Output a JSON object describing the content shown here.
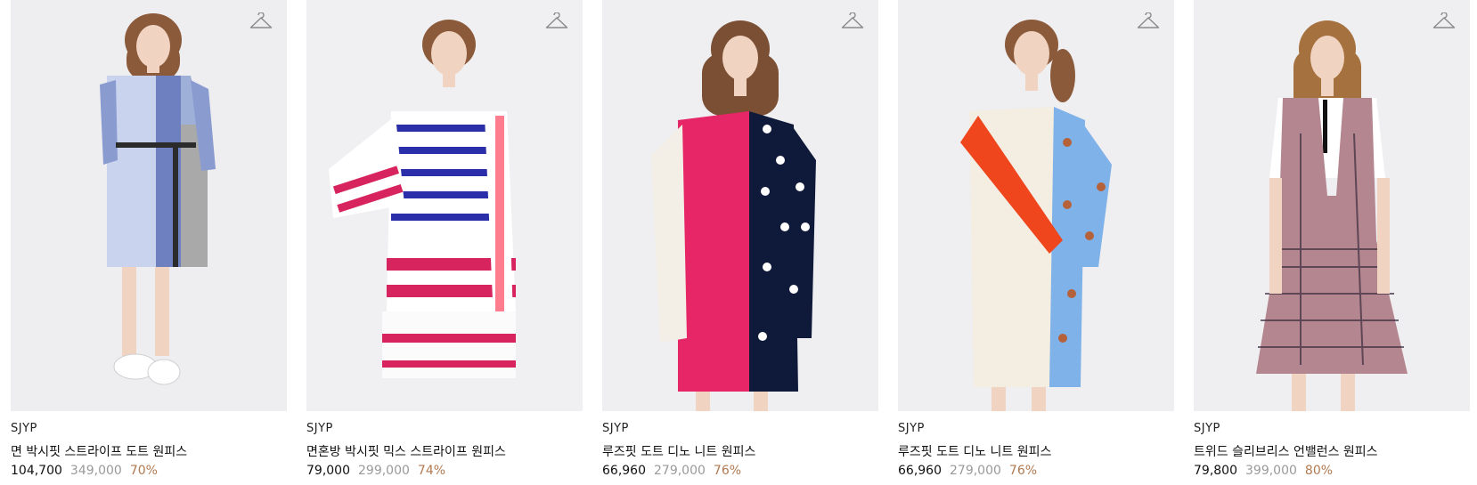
{
  "products": [
    {
      "brand": "SJYP",
      "name": "면 박시핏 스트라이프 도트 원피스",
      "price": "104,700",
      "original_price": "349,000",
      "discount": "70%",
      "colors": {
        "bg": "#eeedf0",
        "hair": "#8a5a3a",
        "main": "#9fb0d8",
        "accent": "#2b2b2b",
        "alt": "#a9a9a9"
      },
      "wishlist_icon": "hanger-icon"
    },
    {
      "brand": "SJYP",
      "name": "면혼방 박시핏 믹스 스트라이프 원피스",
      "price": "79,000",
      "original_price": "299,000",
      "discount": "74%",
      "colors": {
        "bg": "#f0eff2",
        "hair": "#8a5a3a",
        "main": "#ffffff",
        "accent": "#2a2ea8",
        "alt": "#d8245e"
      },
      "wishlist_icon": "hanger-icon"
    },
    {
      "brand": "SJYP",
      "name": "루즈핏 도트 디노 니트 원피스",
      "price": "66,960",
      "original_price": "279,000",
      "discount": "76%",
      "colors": {
        "bg": "#efeef1",
        "hair": "#7a4f34",
        "main": "#e62666",
        "accent": "#0f1a3a",
        "alt": "#f4efe6"
      },
      "wishlist_icon": "hanger-icon"
    },
    {
      "brand": "SJYP",
      "name": "루즈핏 도트 디노 니트 원피스",
      "price": "66,960",
      "original_price": "279,000",
      "discount": "76%",
      "colors": {
        "bg": "#efeef1",
        "hair": "#8a5a3a",
        "main": "#f3ede2",
        "accent": "#7fb2e8",
        "alt": "#f0461e"
      },
      "wishlist_icon": "hanger-icon"
    },
    {
      "brand": "SJYP",
      "name": "트위드 슬리브리스 언밸런스 원피스",
      "price": "79,800",
      "original_price": "399,000",
      "discount": "80%",
      "colors": {
        "bg": "#efeef1",
        "hair": "#a5713e",
        "main": "#b4868f",
        "accent": "#3a2b3f",
        "alt": "#ffffff"
      },
      "wishlist_icon": "hanger-icon"
    }
  ]
}
